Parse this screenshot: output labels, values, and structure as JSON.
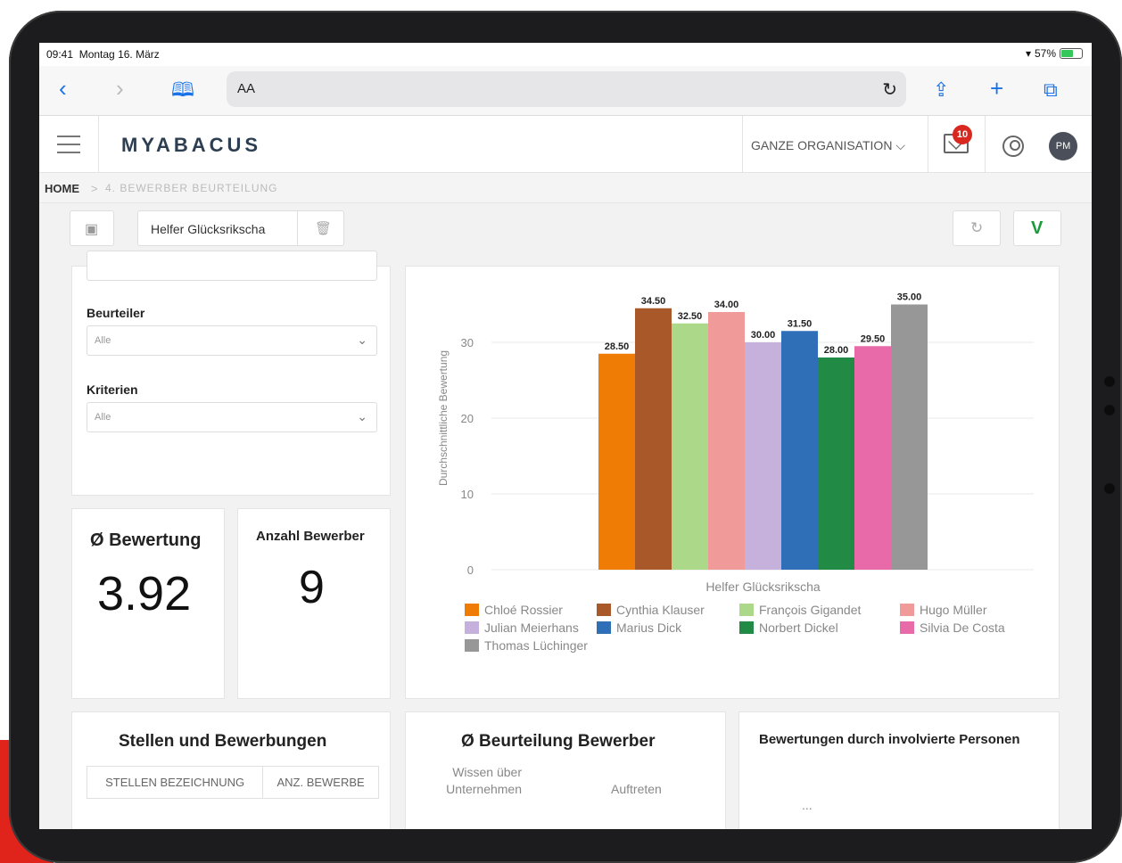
{
  "status": {
    "time": "09:41",
    "date": "Montag 16. März",
    "battery": "57%",
    "battery_level": 0.57
  },
  "browser": {
    "text_size": "AA",
    "icons": [
      "back-icon",
      "forward-icon",
      "bookmarks-icon",
      "reload-icon",
      "share-icon",
      "new-tab-icon",
      "tabs-icon"
    ]
  },
  "app": {
    "logo": "MYABACUS",
    "org_selector": "GANZE ORGANISATION",
    "notifications": "10",
    "user_initials": "PM"
  },
  "breadcrumb": {
    "home": "HOME",
    "separator": ">",
    "current": "4. BEWERBER BEURTEILUNG"
  },
  "toolbar": {
    "title": "Helfer Glücksrikscha",
    "approve_label": "V"
  },
  "filters": {
    "beurteiler_label": "Beurteiler",
    "beurteiler_value": "Alle",
    "kriterien_label": "Kriterien",
    "kriterien_value": "Alle"
  },
  "kpis": {
    "avg_title": "Ø Bewertung",
    "avg_value": "3.92",
    "count_title": "Anzahl Bewerber",
    "count_value": "9"
  },
  "chart_data": {
    "type": "bar",
    "title": "",
    "xlabel": "Helfer Glücksrikscha",
    "ylabel": "Durchschnittliche Bewertung",
    "ylim": [
      0,
      40
    ],
    "yticks": [
      0,
      10,
      20,
      30
    ],
    "grid": true,
    "legend_position": "bottom",
    "series": [
      {
        "name": "Chloé Rossier",
        "value": 28.5,
        "label": "28.50",
        "color": "#ef7d05"
      },
      {
        "name": "Cynthia Klauser",
        "value": 34.5,
        "label": "34.50",
        "color": "#a9582a"
      },
      {
        "name": "François Gigandet",
        "value": 32.5,
        "label": "32.50",
        "color": "#acd88a"
      },
      {
        "name": "Hugo Müller",
        "value": 34.0,
        "label": "34.00",
        "color": "#f19a9a"
      },
      {
        "name": "Julian Meierhans",
        "value": 30.0,
        "label": "30.00",
        "color": "#c6b1dc"
      },
      {
        "name": "Marius Dick",
        "value": 31.5,
        "label": "31.50",
        "color": "#2f6fb8"
      },
      {
        "name": "Norbert Dickel",
        "value": 28.0,
        "label": "28.00",
        "color": "#218a45"
      },
      {
        "name": "Silvia De Costa",
        "value": 29.5,
        "label": "29.50",
        "color": "#e96aa8"
      },
      {
        "name": "Thomas Lüchinger",
        "value": 35.0,
        "label": "35.00",
        "color": "#979797"
      }
    ]
  },
  "bottom": {
    "stellen_title": "Stellen und Bewerbungen",
    "stellen_col1": "STELLEN BEZEICHNUNG",
    "stellen_col2": "ANZ. BEWERBE",
    "beurteilung_title": "Ø Beurteilung Bewerber",
    "radar_label_1": "Wissen über Unternehmen",
    "radar_label_2": "Auftreten",
    "personen_title": "Bewertungen durch involvierte Personen",
    "personen_more": "..."
  }
}
